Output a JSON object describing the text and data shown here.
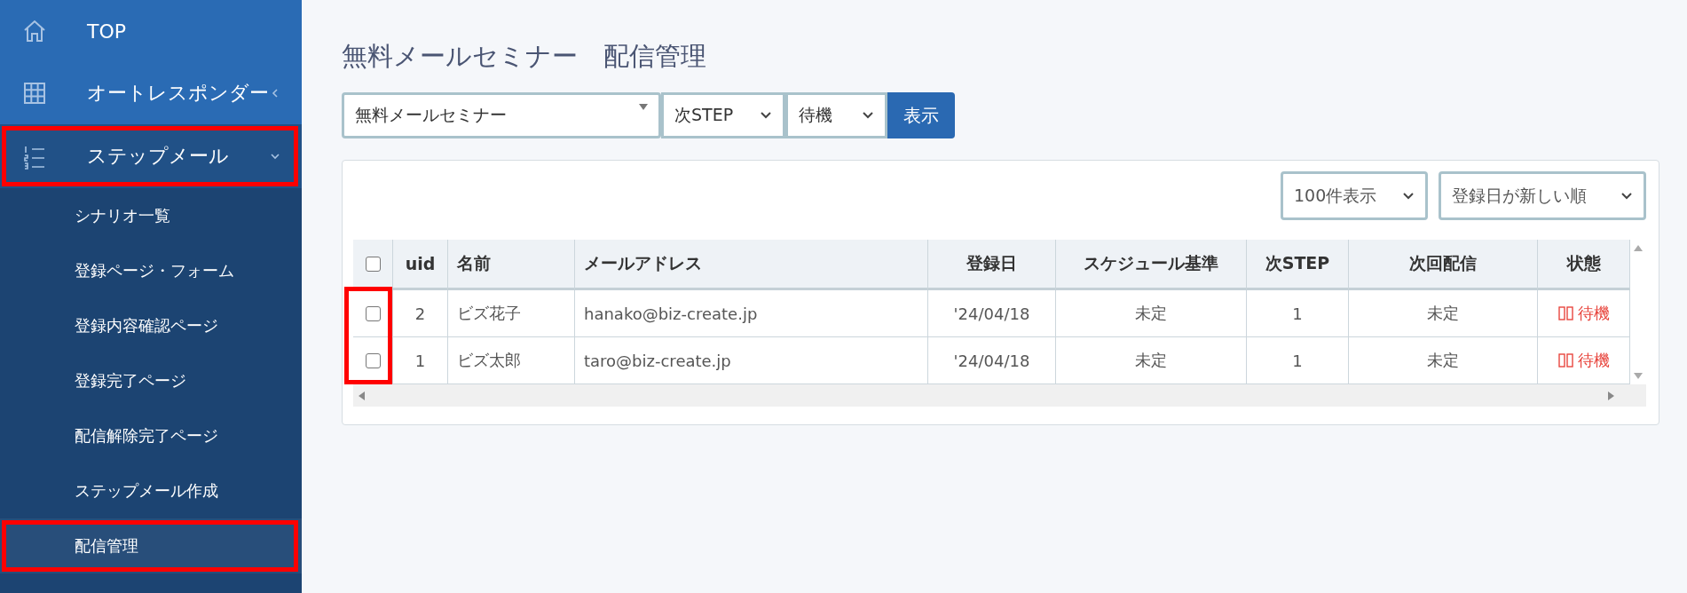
{
  "sidebar": {
    "items": [
      {
        "label": "TOP",
        "annotated": false
      },
      {
        "label": "オートレスポンダー",
        "expanded": false,
        "annotated": false
      },
      {
        "label": "ステップメール",
        "expanded": true,
        "annotated": true,
        "children": [
          {
            "label": "シナリオ一覧",
            "selected": false,
            "annotated": false
          },
          {
            "label": "登録ページ・フォーム",
            "selected": false,
            "annotated": false
          },
          {
            "label": "登録内容確認ページ",
            "selected": false,
            "annotated": false
          },
          {
            "label": "登録完了ページ",
            "selected": false,
            "annotated": false
          },
          {
            "label": "配信解除完了ページ",
            "selected": false,
            "annotated": false
          },
          {
            "label": "ステップメール作成",
            "selected": false,
            "annotated": false
          },
          {
            "label": "配信管理",
            "selected": true,
            "annotated": true
          }
        ]
      }
    ]
  },
  "page": {
    "title": "無料メールセミナー　配信管理"
  },
  "filters": {
    "scenario": "無料メールセミナー",
    "step": "次STEP",
    "status": "待機",
    "button": "表示"
  },
  "table_controls": {
    "per_page": "100件表示",
    "sort": "登録日が新しい順"
  },
  "table": {
    "checkbox_column_annotated": true,
    "header_checked": false,
    "columns": [
      "uid",
      "名前",
      "メールアドレス",
      "登録日",
      "スケジュール基準",
      "次STEP",
      "次回配信",
      "状態"
    ],
    "rows": [
      {
        "checked": false,
        "cells": [
          "2",
          "ビズ花子",
          "hanako@biz-create.jp",
          "'24/04/18",
          "未定",
          "1",
          "未定",
          "待機"
        ]
      },
      {
        "checked": false,
        "cells": [
          "1",
          "ビズ太郎",
          "taro@biz-create.jp",
          "'24/04/18",
          "未定",
          "1",
          "未定",
          "待機"
        ]
      }
    ]
  }
}
